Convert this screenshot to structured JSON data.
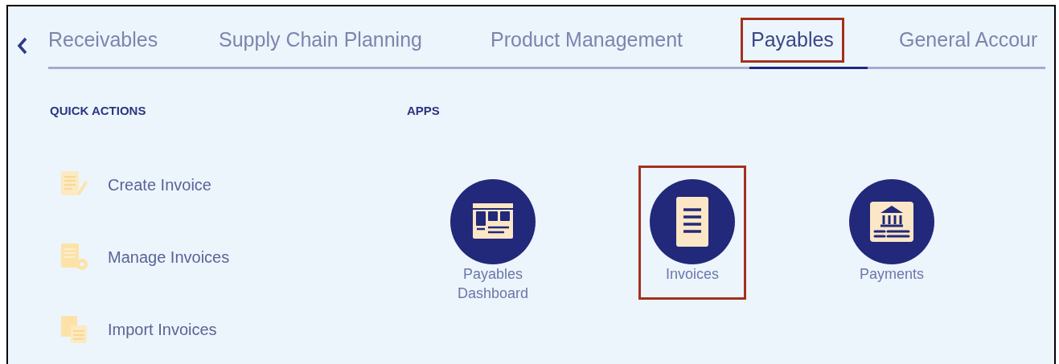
{
  "tabs": [
    {
      "label": "Receivables",
      "selected": false,
      "highlighted": false
    },
    {
      "label": "Supply Chain Planning",
      "selected": false,
      "highlighted": false
    },
    {
      "label": "Product Management",
      "selected": false,
      "highlighted": false
    },
    {
      "label": "Payables",
      "selected": true,
      "highlighted": true
    },
    {
      "label": "General Accour",
      "selected": false,
      "highlighted": false
    }
  ],
  "quick_actions": {
    "heading": "QUICK ACTIONS",
    "items": [
      {
        "label": "Create Invoice",
        "kind": "create"
      },
      {
        "label": "Manage Invoices",
        "kind": "manage"
      },
      {
        "label": "Import Invoices",
        "kind": "import"
      }
    ]
  },
  "apps": {
    "heading": "APPS",
    "items": [
      {
        "label": "Payables Dashboard",
        "kind": "dashboard",
        "highlighted": false
      },
      {
        "label": "Invoices",
        "kind": "invoices",
        "highlighted": true
      },
      {
        "label": "Payments",
        "kind": "payments",
        "highlighted": false
      }
    ]
  }
}
